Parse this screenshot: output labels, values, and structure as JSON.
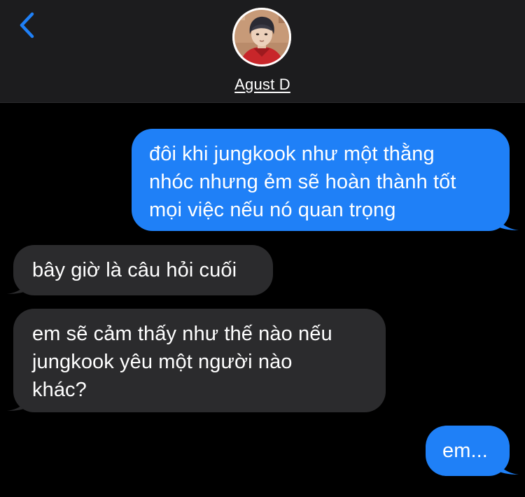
{
  "header": {
    "back_icon": "chevron-left-icon",
    "contact_name": "Agust D",
    "accent_color": "#1f80f7"
  },
  "messages": [
    {
      "direction": "outgoing",
      "lines": [
        "đôi khi jungkook như một thằng",
        "nhóc nhưng ẻm sẽ hoàn thành tốt",
        "mọi việc nếu nó quan trọng"
      ]
    },
    {
      "direction": "incoming",
      "lines": [
        "bây giờ là câu hỏi cuối"
      ]
    },
    {
      "direction": "incoming",
      "lines": [
        "em sẽ cảm thấy như thế nào nếu",
        "jungkook yêu một người nào",
        "khác?"
      ]
    },
    {
      "direction": "outgoing",
      "lines": [
        "em..."
      ]
    }
  ],
  "colors": {
    "outgoing_bubble": "#1f80f7",
    "incoming_bubble": "#2b2b2d",
    "header_background": "#1c1c1e",
    "thread_background": "#000000"
  }
}
